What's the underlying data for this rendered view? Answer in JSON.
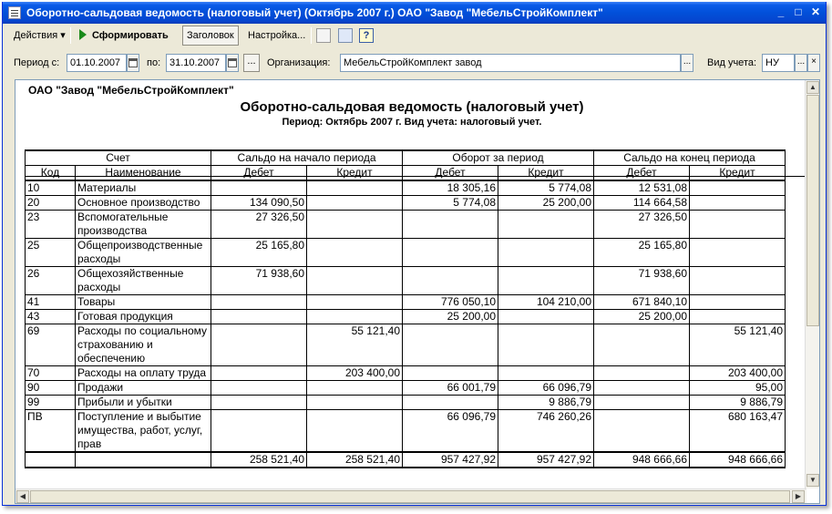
{
  "window": {
    "title": "Оборотно-сальдовая ведомость (налоговый учет) (Октябрь 2007 г.) ОАО \"Завод \"МебельСтройКомплект\"",
    "min_glyph": "_",
    "max_glyph": "□",
    "close_glyph": "✕"
  },
  "toolbar": {
    "actions_label": "Действия ▾",
    "generate_label": "Сформировать",
    "header_label": "Заголовок",
    "settings_label": "Настройка...",
    "help_glyph": "?"
  },
  "filters": {
    "period_from_label": "Период с:",
    "period_from_value": "01.10.2007",
    "period_to_label": "по:",
    "period_to_value": "31.10.2007",
    "org_label": "Организация:",
    "org_value": "МебельСтройКомплект завод",
    "account_type_label": "Вид учета:",
    "account_type_value": "НУ",
    "dots": "...",
    "clear": "×"
  },
  "report": {
    "company": "ОАО \"Завод \"МебельСтройКомплект\"",
    "title": "Оборотно-сальдовая ведомость (налоговый учет)",
    "period": "Период: Октябрь 2007 г. Вид учета: налоговый учет.",
    "groups": [
      "Счет",
      "Сальдо на начало периода",
      "Оборот за период",
      "Сальдо на конец периода"
    ],
    "columns": [
      "Код",
      "Наименование",
      "Дебет",
      "Кредит",
      "Дебет",
      "Кредит",
      "Дебет",
      "Кредит"
    ],
    "rows": [
      {
        "code": "10",
        "name": "Материалы",
        "v": [
          "",
          "",
          "18 305,16",
          "5 774,08",
          "12 531,08",
          ""
        ]
      },
      {
        "code": "20",
        "name": "Основное производство",
        "v": [
          "134 090,50",
          "",
          "5 774,08",
          "25 200,00",
          "114 664,58",
          ""
        ]
      },
      {
        "code": "23",
        "name": "Вспомогательные производства",
        "v": [
          "27 326,50",
          "",
          "",
          "",
          "27 326,50",
          ""
        ]
      },
      {
        "code": "25",
        "name": "Общепроизводственные расходы",
        "v": [
          "25 165,80",
          "",
          "",
          "",
          "25 165,80",
          ""
        ]
      },
      {
        "code": "26",
        "name": "Общехозяйственные расходы",
        "v": [
          "71 938,60",
          "",
          "",
          "",
          "71 938,60",
          ""
        ]
      },
      {
        "code": "41",
        "name": "Товары",
        "v": [
          "",
          "",
          "776 050,10",
          "104 210,00",
          "671 840,10",
          ""
        ]
      },
      {
        "code": "43",
        "name": "Готовая продукция",
        "v": [
          "",
          "",
          "25 200,00",
          "",
          "25 200,00",
          ""
        ]
      },
      {
        "code": "69",
        "name": "Расходы по социальному страхованию и обеспечению",
        "v": [
          "",
          "55 121,40",
          "",
          "",
          "",
          "55 121,40"
        ]
      },
      {
        "code": "70",
        "name": "Расходы на оплату труда",
        "v": [
          "",
          "203 400,00",
          "",
          "",
          "",
          "203 400,00"
        ]
      },
      {
        "code": "90",
        "name": "Продажи",
        "v": [
          "",
          "",
          "66 001,79",
          "66 096,79",
          "",
          "95,00"
        ]
      },
      {
        "code": "99",
        "name": "Прибыли и убытки",
        "v": [
          "",
          "",
          "",
          "9 886,79",
          "",
          "9 886,79"
        ]
      },
      {
        "code": "ПВ",
        "name": "Поступление и выбытие имущества, работ, услуг, прав",
        "v": [
          "",
          "",
          "66 096,79",
          "746 260,26",
          "",
          "680 163,47"
        ]
      }
    ],
    "totals": [
      "258 521,40",
      "258 521,40",
      "957 427,92",
      "957 427,92",
      "948 666,66",
      "948 666,66"
    ]
  }
}
